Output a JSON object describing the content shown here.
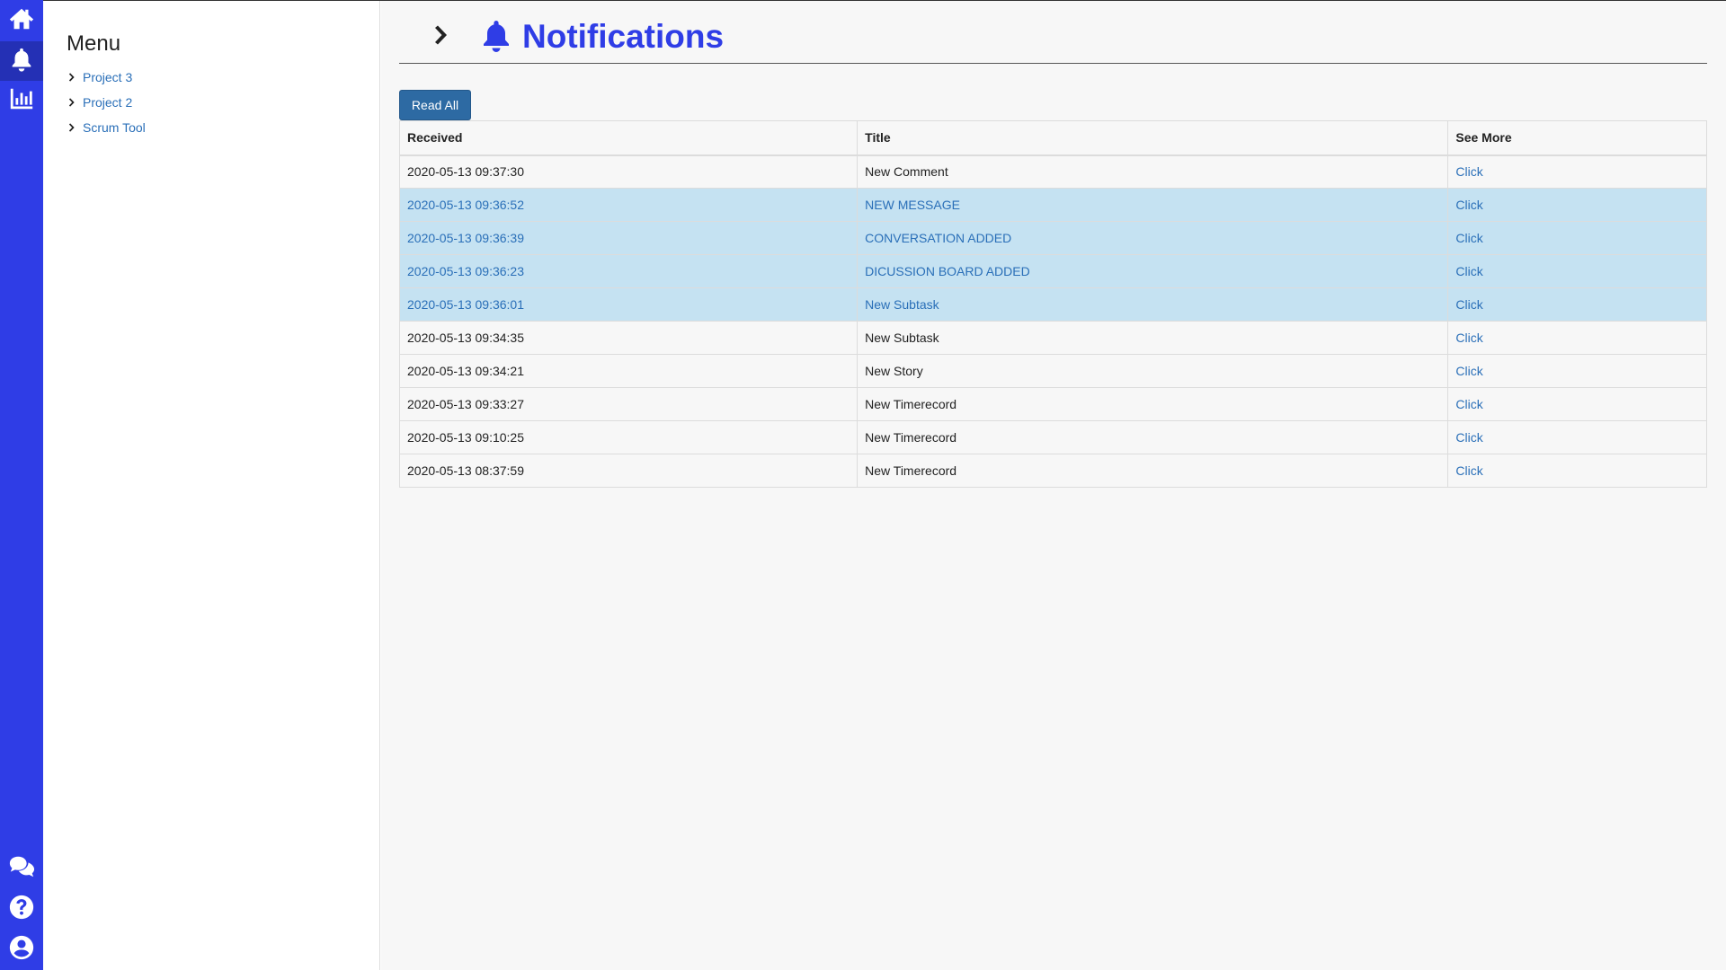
{
  "rail": {
    "top_items": [
      "home-icon",
      "bell-icon",
      "chart-icon"
    ],
    "active": "bell-icon",
    "bottom_items": [
      "chat-icon",
      "help-icon",
      "user-icon"
    ],
    "color": "#2f3de6"
  },
  "menu": {
    "title": "Menu",
    "items": [
      {
        "label": "Project 3"
      },
      {
        "label": "Project 2"
      },
      {
        "label": "Scrum Tool"
      }
    ]
  },
  "header": {
    "title": "Notifications",
    "title_color": "#2f3de6"
  },
  "actions": {
    "read_all_label": "Read All"
  },
  "table": {
    "columns": [
      "Received",
      "Title",
      "See More"
    ],
    "rows": [
      {
        "received": "2020-05-13 09:37:30",
        "title": "New Comment",
        "link": "Click",
        "unread": false
      },
      {
        "received": "2020-05-13 09:36:52",
        "title": "NEW MESSAGE",
        "link": "Click",
        "unread": true
      },
      {
        "received": "2020-05-13 09:36:39",
        "title": "CONVERSATION ADDED",
        "link": "Click",
        "unread": true
      },
      {
        "received": "2020-05-13 09:36:23",
        "title": "DICUSSION BOARD ADDED",
        "link": "Click",
        "unread": true
      },
      {
        "received": "2020-05-13 09:36:01",
        "title": "New Subtask",
        "link": "Click",
        "unread": true
      },
      {
        "received": "2020-05-13 09:34:35",
        "title": "New Subtask",
        "link": "Click",
        "unread": false
      },
      {
        "received": "2020-05-13 09:34:21",
        "title": "New Story",
        "link": "Click",
        "unread": false
      },
      {
        "received": "2020-05-13 09:33:27",
        "title": "New Timerecord",
        "link": "Click",
        "unread": false
      },
      {
        "received": "2020-05-13 09:10:25",
        "title": "New Timerecord",
        "link": "Click",
        "unread": false
      },
      {
        "received": "2020-05-13 08:37:59",
        "title": "New Timerecord",
        "link": "Click",
        "unread": false
      }
    ]
  }
}
